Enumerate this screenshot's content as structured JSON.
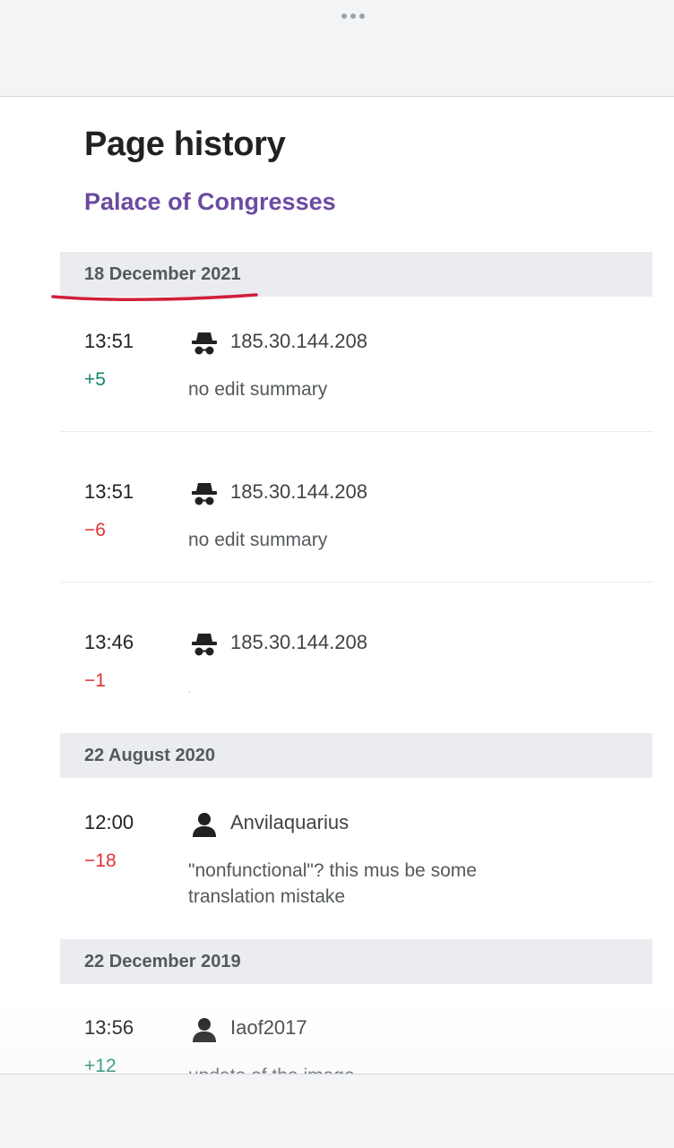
{
  "header": {
    "menu_icon": "more-dots-icon"
  },
  "page": {
    "title": "Page history",
    "article": "Palace of Congresses"
  },
  "groups": [
    {
      "date": "18 December 2021",
      "revisions": [
        {
          "time": "13:51",
          "diff": "+5",
          "user": "185.30.144.208",
          "user_icon": "anonymous-user-icon",
          "summary": "no edit summary"
        },
        {
          "time": "13:51",
          "diff": "−6",
          "user": "185.30.144.208",
          "user_icon": "anonymous-user-icon",
          "summary": "no edit summary"
        },
        {
          "time": "13:46",
          "diff": "−1",
          "user": "185.30.144.208",
          "user_icon": "anonymous-user-icon",
          "summary": "."
        }
      ]
    },
    {
      "date": "22 August 2020",
      "revisions": [
        {
          "time": "12:00",
          "diff": "−18",
          "user": "Anvilaquarius",
          "user_icon": "user-icon",
          "summary": "\"nonfunctional\"? this mus be some translation mistake"
        }
      ]
    },
    {
      "date": "22 December 2019",
      "revisions": [
        {
          "time": "13:56",
          "diff": "+12",
          "user": "Iaof2017",
          "user_icon": "user-icon",
          "summary": "update of the image"
        }
      ]
    }
  ],
  "colors": {
    "link": "#6b4ba1",
    "positive_diff": "#14866d",
    "negative_diff": "#dd3333",
    "date_header_bg": "#eaecf0",
    "annotation_underline": "#d0203a"
  }
}
